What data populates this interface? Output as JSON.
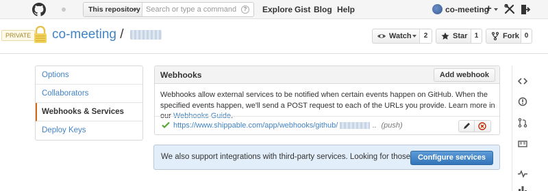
{
  "colors": {
    "link": "#4183c4",
    "accent": "#d26911",
    "primary_button": "#3274b9",
    "info_bg": "#e2eef9"
  },
  "header": {
    "logo_icon": "github-octocat-icon",
    "search": {
      "scope_label": "This repository",
      "placeholder": "Search or type a command",
      "help_icon": "?"
    },
    "nav": [
      "Explore",
      "Gist",
      "Blog",
      "Help"
    ],
    "user": {
      "name": "co-meeting"
    },
    "new_label": "+"
  },
  "repo": {
    "visibility": "PRIVATE",
    "owner": "co-meeting",
    "separator": "/",
    "actions": [
      {
        "label": "Watch",
        "count": "2",
        "icon": "eye-icon"
      },
      {
        "label": "Star",
        "count": "1",
        "icon": "star-icon"
      },
      {
        "label": "Fork",
        "count": "0",
        "icon": "fork-icon"
      }
    ]
  },
  "sidebar": {
    "items": [
      {
        "label": "Options"
      },
      {
        "label": "Collaborators"
      },
      {
        "label": "Webhooks & Services"
      },
      {
        "label": "Deploy Keys"
      }
    ]
  },
  "webhooks": {
    "title": "Webhooks",
    "add_label": "Add webhook",
    "description": "Webhooks allow external services to be notified when certain events happen on GitHub. When the specified events happen, we'll send a POST request to each of the URLs you provide. Learn more in our",
    "guide_link": "Webhooks Guide",
    "period": ".",
    "hook": {
      "url": "https://www.shippable.com/app/webhooks/github/",
      "ellipsis": "..",
      "events": "(push)"
    }
  },
  "integrations": {
    "text": "We also support integrations with third-party services. Looking for those?",
    "button": "Configure services"
  }
}
